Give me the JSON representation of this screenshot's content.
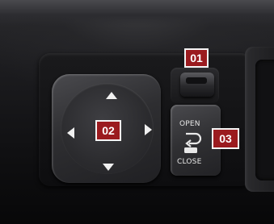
{
  "callouts": {
    "switch": "01",
    "dpad": "02",
    "open_close": "03"
  },
  "button_labels": {
    "open": "OPEN",
    "close": "CLOSE"
  },
  "colors": {
    "callout_fill": "#9b1b1f",
    "callout_border": "#f5f5f5",
    "arrow": "#f0f0f0"
  }
}
